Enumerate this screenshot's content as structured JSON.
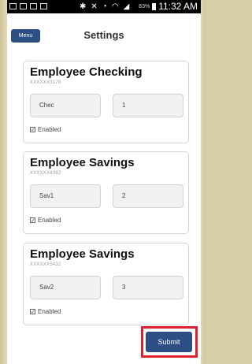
{
  "status_bar": {
    "battery_percent": "83%",
    "time": "11:32 AM"
  },
  "header": {
    "menu_label": "Menu",
    "title": "Settings"
  },
  "accounts": [
    {
      "title": "Employee Checking",
      "account_number": "XXXXXX3178",
      "abbrev": "Chec",
      "order": "1",
      "enabled_label": "Enabled"
    },
    {
      "title": "Employee Savings",
      "account_number": "XXXXXX4392",
      "abbrev": "Sav1",
      "order": "2",
      "enabled_label": "Enabled"
    },
    {
      "title": "Employee Savings",
      "account_number": "XXXXXX5432",
      "abbrev": "Sav2",
      "order": "3",
      "enabled_label": "Enabled"
    }
  ],
  "submit_label": "Submit",
  "colors": {
    "primary": "#2d4f86",
    "highlight": "#e0202c"
  }
}
